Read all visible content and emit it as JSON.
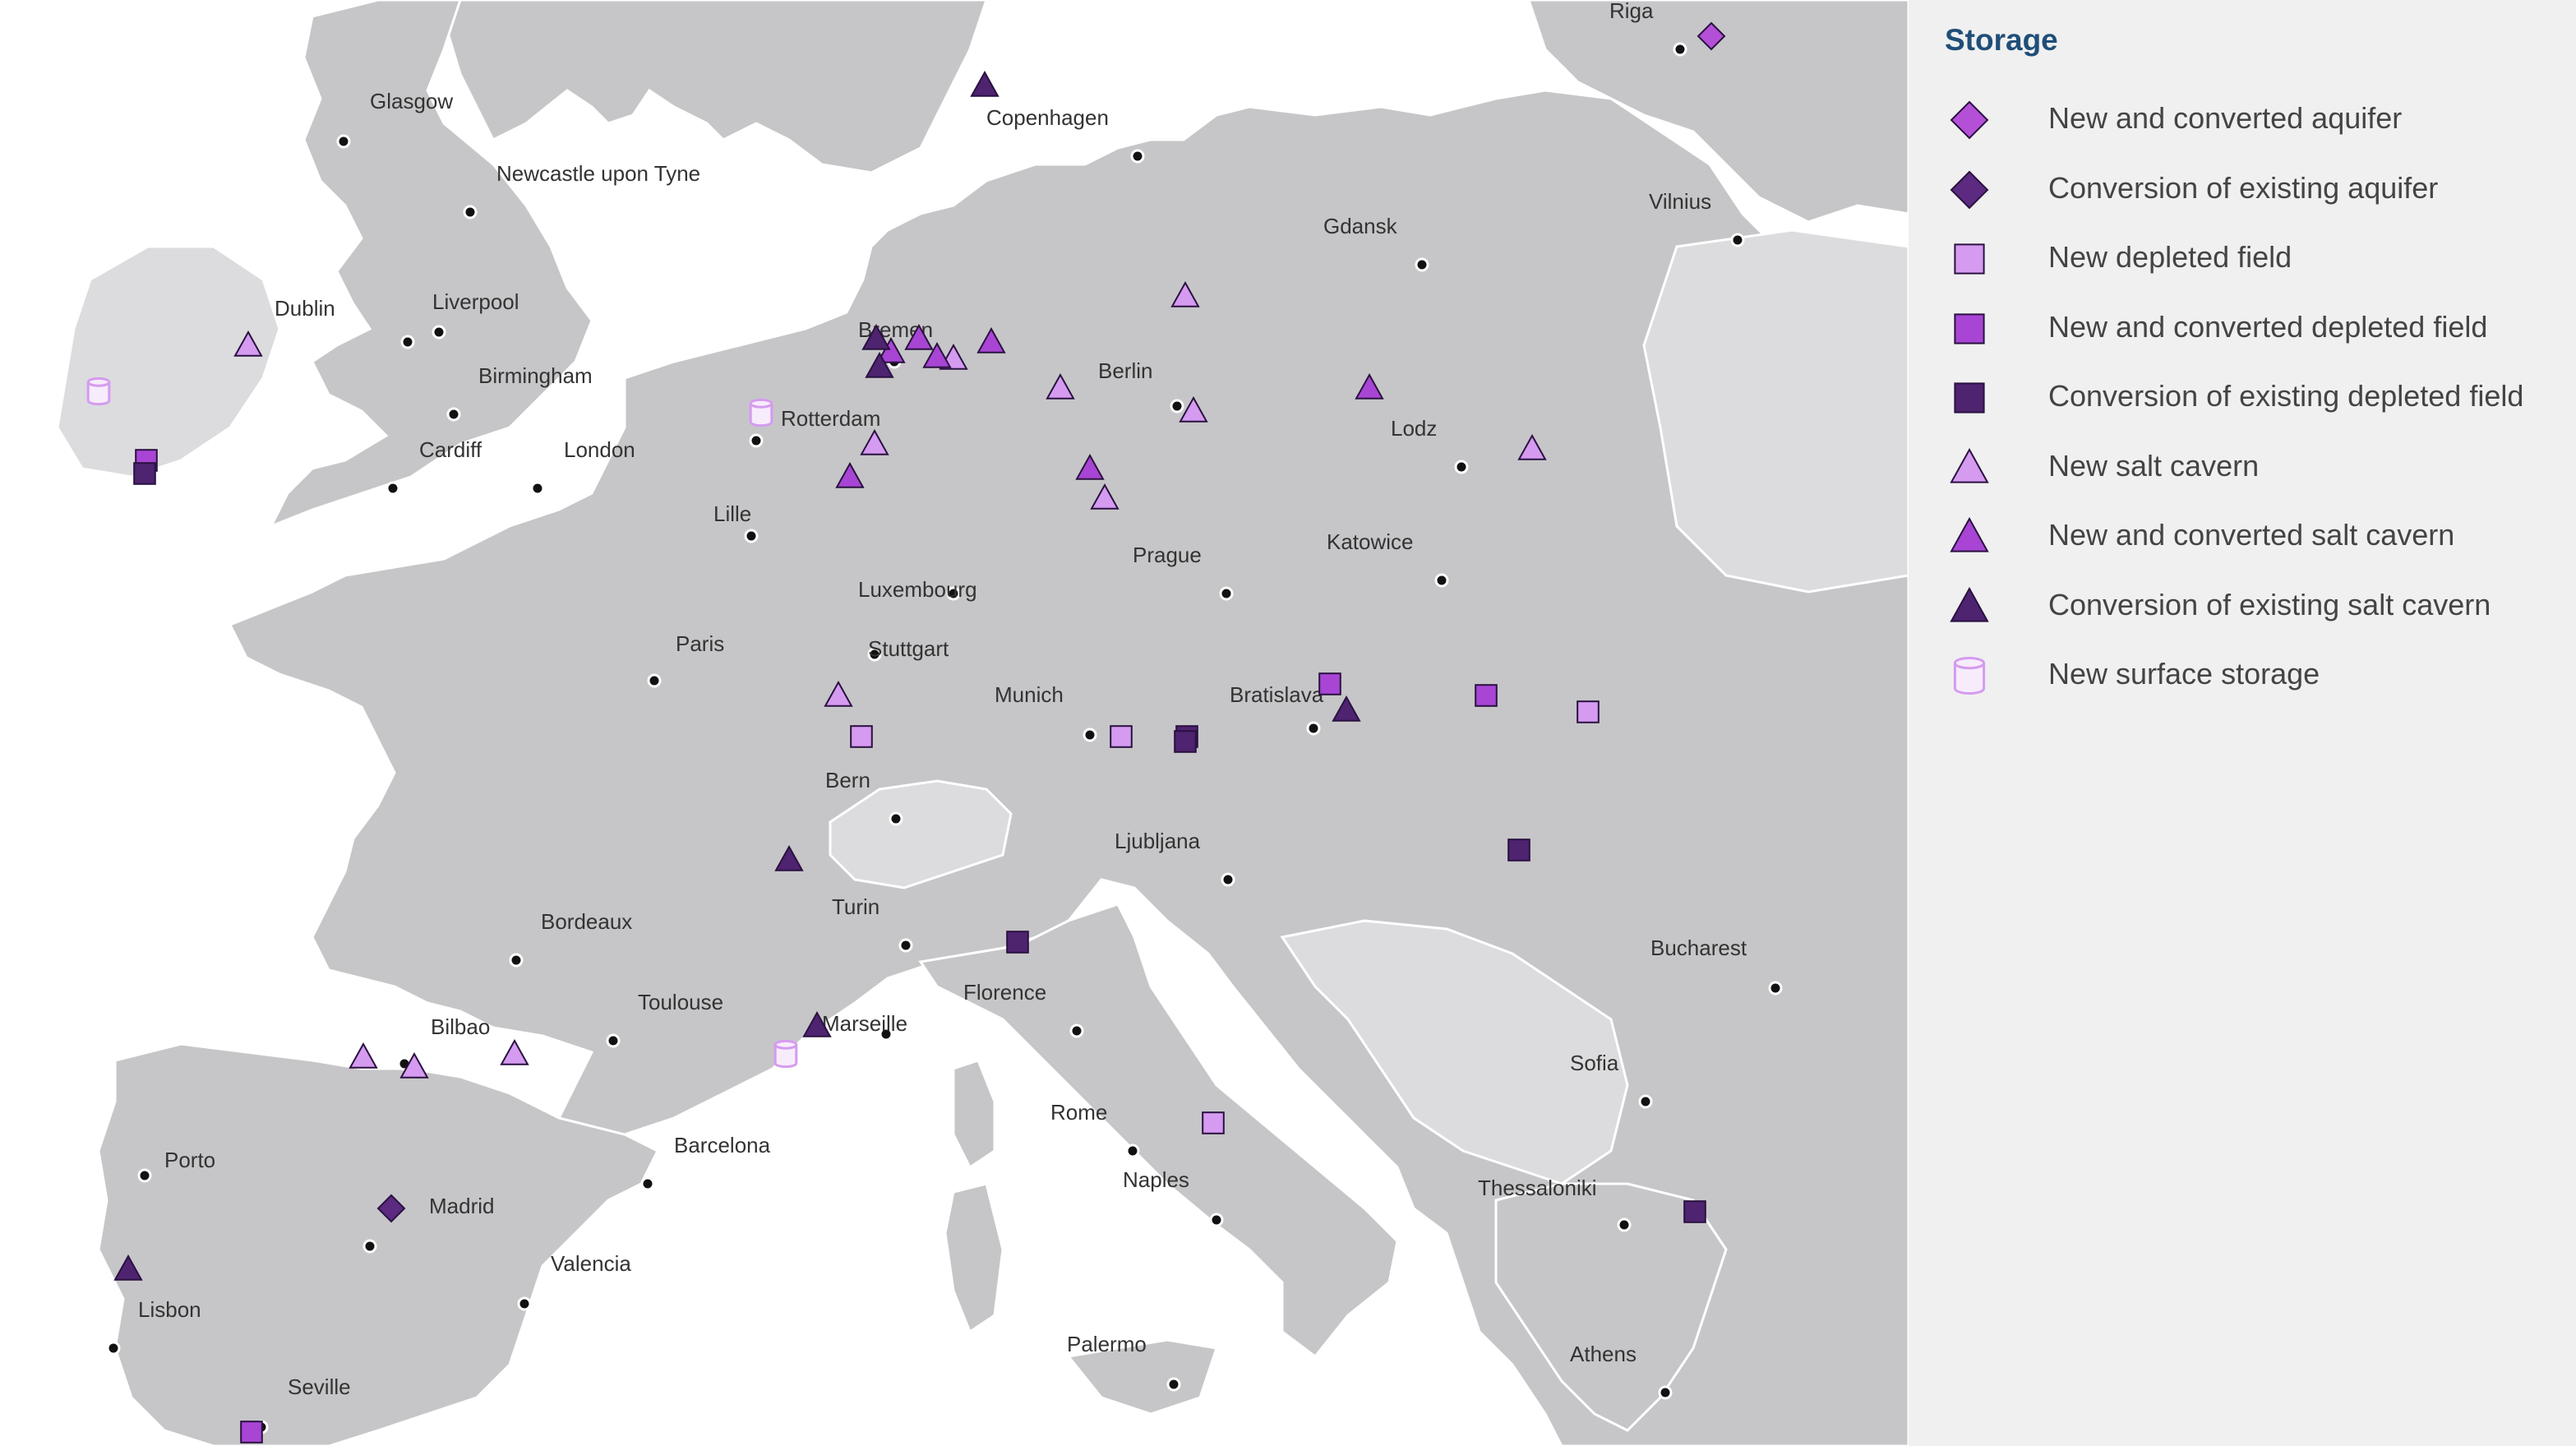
{
  "legend": {
    "title": "Storage",
    "items": [
      {
        "key": "aquifer_new",
        "label": "New and converted aquifer",
        "shape": "diamond-icon",
        "color": "#b450d8"
      },
      {
        "key": "aquifer_conv",
        "label": "Conversion of existing aquifer",
        "shape": "diamond-icon",
        "color": "#5c2a80"
      },
      {
        "key": "depleted_new",
        "label": "New depleted field",
        "shape": "square-icon",
        "color": "#d59bf0"
      },
      {
        "key": "depleted_newconv",
        "label": "New and converted depleted field",
        "shape": "square-icon",
        "color": "#a845d4"
      },
      {
        "key": "depleted_conv",
        "label": "Conversion of existing depleted field",
        "shape": "square-icon",
        "color": "#4e2370"
      },
      {
        "key": "salt_new",
        "label": "New salt cavern",
        "shape": "triangle-icon",
        "color": "#d59bf0"
      },
      {
        "key": "salt_newconv",
        "label": "New and converted salt cavern",
        "shape": "triangle-icon",
        "color": "#a845d4"
      },
      {
        "key": "salt_conv",
        "label": "Conversion of existing salt cavern",
        "shape": "triangle-icon",
        "color": "#4e2370"
      },
      {
        "key": "surface_new",
        "label": "New surface storage",
        "shape": "cylinder-icon",
        "color": "#d59bf0"
      }
    ]
  },
  "cities": [
    {
      "name": "Glasgow",
      "label": "Glasgow"
    },
    {
      "name": "Newcastle upon Tyne",
      "label": "Newcastle upon Tyne"
    },
    {
      "name": "Dublin",
      "label": "Dublin"
    },
    {
      "name": "Liverpool",
      "label": "Liverpool"
    },
    {
      "name": "Birmingham",
      "label": "Birmingham"
    },
    {
      "name": "Cardiff",
      "label": "Cardiff"
    },
    {
      "name": "London",
      "label": "London"
    },
    {
      "name": "Copenhagen",
      "label": "Copenhagen"
    },
    {
      "name": "Riga",
      "label": "Riga"
    },
    {
      "name": "Vilnius",
      "label": "Vilnius"
    },
    {
      "name": "Gdansk",
      "label": "Gdansk"
    },
    {
      "name": "Bremen",
      "label": "Bremen"
    },
    {
      "name": "Berlin",
      "label": "Berlin"
    },
    {
      "name": "Rotterdam",
      "label": "Rotterdam"
    },
    {
      "name": "Lodz",
      "label": "Lodz"
    },
    {
      "name": "Lille",
      "label": "Lille"
    },
    {
      "name": "Prague",
      "label": "Prague"
    },
    {
      "name": "Katowice",
      "label": "Katowice"
    },
    {
      "name": "Luxembourg",
      "label": "Luxembourg"
    },
    {
      "name": "Paris",
      "label": "Paris"
    },
    {
      "name": "Stuttgart",
      "label": "Stuttgart"
    },
    {
      "name": "Munich",
      "label": "Munich"
    },
    {
      "name": "Bratislava",
      "label": "Bratislava"
    },
    {
      "name": "Bern",
      "label": "Bern"
    },
    {
      "name": "Ljubljana",
      "label": "Ljubljana"
    },
    {
      "name": "Turin",
      "label": "Turin"
    },
    {
      "name": "Bordeaux",
      "label": "Bordeaux"
    },
    {
      "name": "Bucharest",
      "label": "Bucharest"
    },
    {
      "name": "Toulouse",
      "label": "Toulouse"
    },
    {
      "name": "Florence",
      "label": "Florence"
    },
    {
      "name": "Bilbao",
      "label": "Bilbao"
    },
    {
      "name": "Marseille",
      "label": "Marseille"
    },
    {
      "name": "Sofia",
      "label": "Sofia"
    },
    {
      "name": "Rome",
      "label": "Rome"
    },
    {
      "name": "Barcelona",
      "label": "Barcelona"
    },
    {
      "name": "Porto",
      "label": "Porto"
    },
    {
      "name": "Madrid",
      "label": "Madrid"
    },
    {
      "name": "Naples",
      "label": "Naples"
    },
    {
      "name": "Thessaloniki",
      "label": "Thessaloniki"
    },
    {
      "name": "Valencia",
      "label": "Valencia"
    },
    {
      "name": "Lisbon",
      "label": "Lisbon"
    },
    {
      "name": "Palermo",
      "label": "Palermo"
    },
    {
      "name": "Athens",
      "label": "Athens"
    },
    {
      "name": "Seville",
      "label": "Seville"
    }
  ],
  "markers": [
    {
      "type": "aquifer_new"
    },
    {
      "type": "aquifer_conv"
    },
    {
      "type": "depleted_new"
    },
    {
      "type": "depleted_new"
    },
    {
      "type": "depleted_new"
    },
    {
      "type": "depleted_new"
    },
    {
      "type": "depleted_newconv"
    },
    {
      "type": "depleted_newconv"
    },
    {
      "type": "depleted_newconv"
    },
    {
      "type": "depleted_newconv"
    },
    {
      "type": "depleted_conv"
    },
    {
      "type": "depleted_conv"
    },
    {
      "type": "depleted_conv"
    },
    {
      "type": "depleted_conv"
    },
    {
      "type": "depleted_conv"
    },
    {
      "type": "depleted_conv"
    },
    {
      "type": "salt_new"
    },
    {
      "type": "salt_new"
    },
    {
      "type": "salt_new"
    },
    {
      "type": "salt_new"
    },
    {
      "type": "salt_new"
    },
    {
      "type": "salt_new"
    },
    {
      "type": "salt_new"
    },
    {
      "type": "salt_new"
    },
    {
      "type": "salt_new"
    },
    {
      "type": "salt_new"
    },
    {
      "type": "salt_new"
    },
    {
      "type": "salt_new"
    },
    {
      "type": "salt_newconv"
    },
    {
      "type": "salt_newconv"
    },
    {
      "type": "salt_newconv"
    },
    {
      "type": "salt_newconv"
    },
    {
      "type": "salt_newconv"
    },
    {
      "type": "salt_newconv"
    },
    {
      "type": "salt_newconv"
    },
    {
      "type": "salt_conv"
    },
    {
      "type": "salt_conv"
    },
    {
      "type": "salt_conv"
    },
    {
      "type": "salt_conv"
    },
    {
      "type": "salt_conv"
    },
    {
      "type": "salt_conv"
    },
    {
      "type": "salt_conv"
    },
    {
      "type": "surface_new"
    },
    {
      "type": "surface_new"
    },
    {
      "type": "surface_new"
    }
  ]
}
